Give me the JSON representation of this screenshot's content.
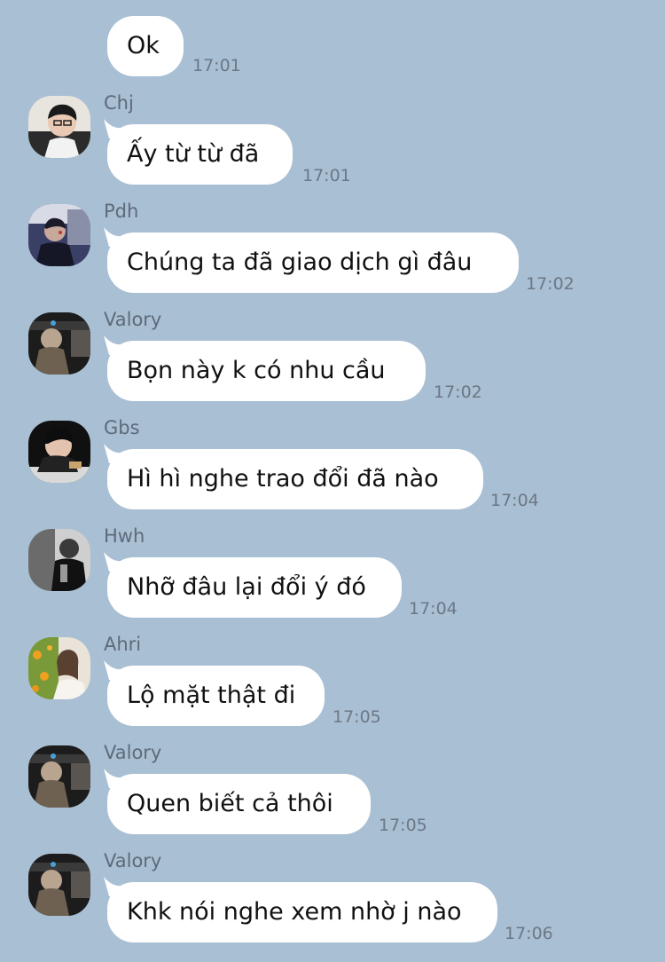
{
  "messages": [
    {
      "name": "",
      "text": "Ok",
      "time": "17:01",
      "avatar": ""
    },
    {
      "name": "Chj",
      "text": "Ấy từ từ đã",
      "time": "17:01",
      "avatar": "chj-avatar"
    },
    {
      "name": "Pdh",
      "text": "Chúng ta đã giao dịch gì đâu",
      "time": "17:02",
      "avatar": "pdh-avatar"
    },
    {
      "name": "Valory",
      "text": "Bọn này k có nhu cầu",
      "time": "17:02",
      "avatar": "valory-avatar"
    },
    {
      "name": "Gbs",
      "text": "Hì hì nghe trao đổi đã nào",
      "time": "17:04",
      "avatar": "gbs-avatar"
    },
    {
      "name": "Hwh",
      "text": "Nhỡ đâu lại đổi ý đó",
      "time": "17:04",
      "avatar": "hwh-avatar"
    },
    {
      "name": "Ahri",
      "text": "Lộ mặt thật đi",
      "time": "17:05",
      "avatar": "ahri-avatar"
    },
    {
      "name": "Valory",
      "text": "Quen biết cả thôi",
      "time": "17:05",
      "avatar": "valory-avatar"
    },
    {
      "name": "Valory",
      "text": "Khk nói nghe xem nhờ j nào",
      "time": "17:06",
      "avatar": "valory-avatar"
    }
  ],
  "colors": {
    "background": "#a9bfd4",
    "bubble": "#ffffff",
    "sender": "#5d6b79",
    "time": "#6b7885"
  }
}
